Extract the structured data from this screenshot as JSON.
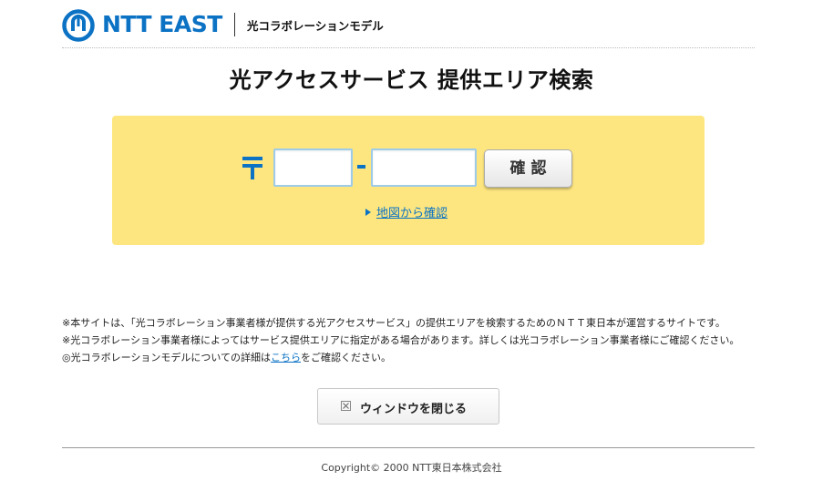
{
  "header": {
    "logo_text": "NTT EAST",
    "subtitle": "光コラボレーションモデル"
  },
  "page_title": "光アクセスサービス 提供エリア検索",
  "search": {
    "postal_mark": "〒",
    "zip1_value": "",
    "zip2_value": "",
    "confirm_label": "確認",
    "map_link_label": "地図から確認"
  },
  "notes": {
    "line1": "※本サイトは、「光コラボレーション事業者様が提供する光アクセスサービス」の提供エリアを検索するためのＮＴＴ東日本が運営するサイトです。",
    "line2": "※光コラボレーション事業者様によってはサービス提供エリアに指定がある場合があります。詳しくは光コラボレーション事業者様にご確認ください。",
    "line3_prefix": "◎光コラボレーションモデルについての詳細は",
    "line3_link": "こちら",
    "line3_suffix": "をご確認ください。"
  },
  "close_button_label": "ウィンドウを閉じる",
  "footer": {
    "copyright": "Copyright© 2000 NTT東日本株式会社"
  },
  "colors": {
    "brand_blue": "#0b72c4",
    "panel_yellow": "#fde680"
  }
}
